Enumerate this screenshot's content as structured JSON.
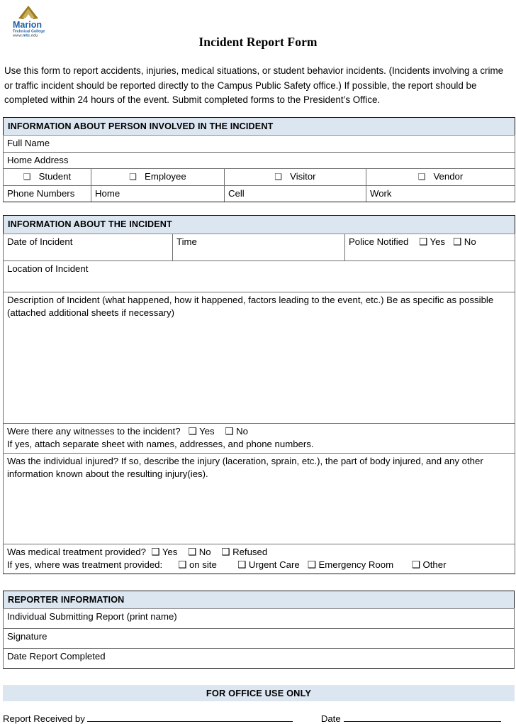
{
  "logo": {
    "name_line1": "Marion",
    "name_line2": "Technical College",
    "url": "www.mtc.edu",
    "brand_blue": "#1b5fa8",
    "brand_gold": "#9a7b1e"
  },
  "title": "Incident Report Form",
  "intro": "Use this form to report accidents, injuries, medical situations, or student behavior incidents. (Incidents involving a crime or traffic incident should be reported directly to the Campus Public Safety office.) If possible, the report should be completed within 24 hours of the event. Submit completed forms to the President’s Office.",
  "accent_header_bg": "#dce6f1",
  "section_person": {
    "heading": "INFORMATION ABOUT PERSON INVOLVED IN THE INCIDENT",
    "full_name_label": "Full Name",
    "home_address_label": "Home Address",
    "role_options": [
      "Student",
      "Employee",
      "Visitor",
      "Vendor"
    ],
    "phone_label": "Phone Numbers",
    "phone_fields": [
      "Home",
      "Cell",
      "Work"
    ]
  },
  "section_incident": {
    "heading": "INFORMATION ABOUT THE INCIDENT",
    "date_label": "Date of Incident",
    "time_label": "Time",
    "police_label": "Police Notified",
    "police_options": [
      "Yes",
      "No"
    ],
    "location_label": "Location of Incident",
    "description_label": "Description of Incident (what happened, how it happened, factors leading to the event, etc.) Be as specific as possible (attached additional sheets if necessary)",
    "witness_question": "Were there any witnesses to the incident?",
    "witness_options": [
      "Yes",
      "No"
    ],
    "witness_note": "If yes, attach separate sheet with names, addresses, and phone numbers.",
    "injury_question": "Was the individual injured? If so, describe the injury (laceration, sprain, etc.), the part of body injured, and any other information known about the resulting injury(ies).",
    "treatment_question": "Was medical treatment provided?",
    "treatment_options": [
      "Yes",
      "No",
      "Refused"
    ],
    "treatment_where_label": "If yes, where was treatment provided:",
    "treatment_where_options": [
      "on site",
      "Urgent Care",
      "Emergency Room",
      "Other"
    ]
  },
  "section_reporter": {
    "heading": "REPORTER INFORMATION",
    "submitter_label": "Individual Submitting Report (print name)",
    "signature_label": "Signature",
    "date_completed_label": "Date Report Completed"
  },
  "section_office": {
    "heading": "FOR OFFICE USE ONLY",
    "received_by_label": "Report Received by",
    "date_label": "Date"
  },
  "icons": {
    "checkbox_thin": "❑",
    "checkbox": "❑"
  }
}
